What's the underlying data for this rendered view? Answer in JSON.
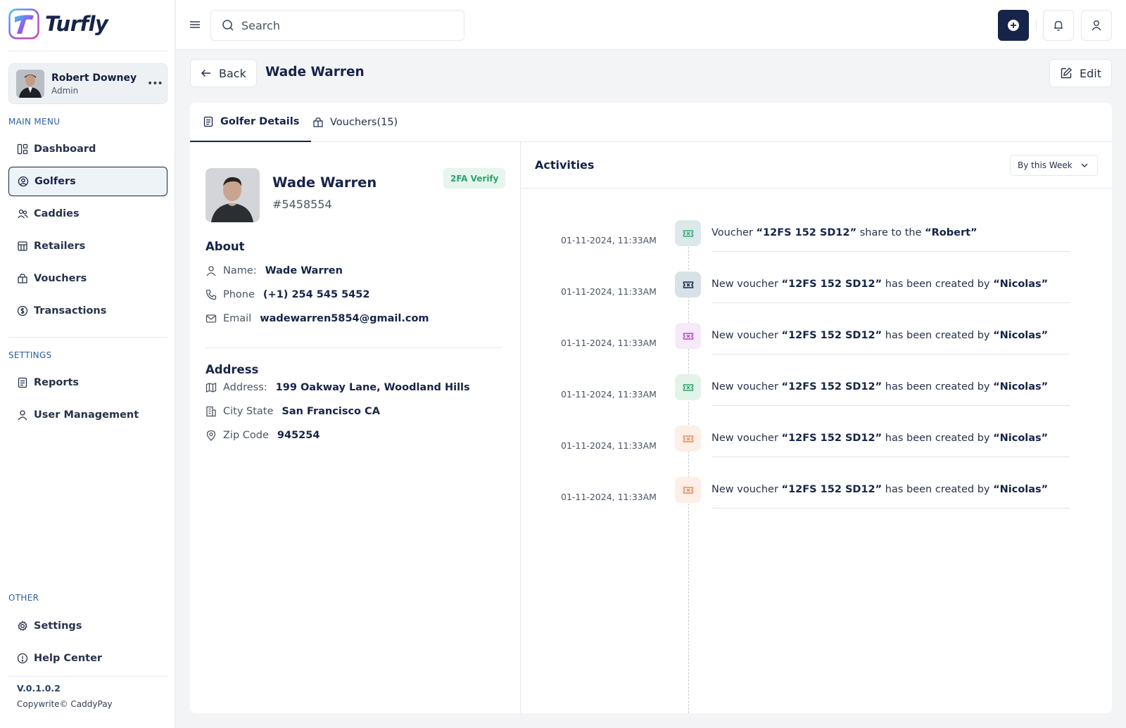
{
  "brand": {
    "name": "Turfly"
  },
  "user": {
    "name": "Robert Downey",
    "role": "Admin",
    "more": "•••"
  },
  "sidebar": {
    "main_label": "MAIN MENU",
    "main_items": [
      {
        "label": "Dashboard",
        "icon": "dashboard-icon"
      },
      {
        "label": "Golfers",
        "icon": "golfer-icon",
        "active": true
      },
      {
        "label": "Caddies",
        "icon": "users-icon"
      },
      {
        "label": "Retailers",
        "icon": "store-icon"
      },
      {
        "label": "Vouchers",
        "icon": "voucher-icon"
      },
      {
        "label": "Transactions",
        "icon": "dollar-icon"
      }
    ],
    "settings_label": "SETTINGS",
    "settings_items": [
      {
        "label": "Reports",
        "icon": "report-icon"
      },
      {
        "label": "User Management",
        "icon": "user-icon"
      }
    ],
    "other_label": "OTHER",
    "other_items": [
      {
        "label": "Settings",
        "icon": "gear-icon"
      },
      {
        "label": "Help Center",
        "icon": "info-icon"
      }
    ],
    "version": "V.0.1.0.2",
    "copyright": "Copywrite© CaddyPay"
  },
  "topbar": {
    "search_placeholder": "Search"
  },
  "header": {
    "back_label": "Back",
    "title": "Wade Warren",
    "edit_label": "Edit"
  },
  "tabs": [
    {
      "label": "Golfer Details",
      "active": true
    },
    {
      "label": "Vouchers(15)"
    }
  ],
  "golfer": {
    "name": "Wade Warren",
    "id": "#5458554",
    "badge": "2FA Verify",
    "about_title": "About",
    "about": [
      {
        "label": "Name:",
        "value": "Wade Warren",
        "icon": "person-icon"
      },
      {
        "label": "Phone",
        "value": "(+1) 254 545 5452",
        "icon": "phone-icon"
      },
      {
        "label": "Email",
        "value": "wadewarren5854@gmail.com",
        "icon": "mail-icon"
      }
    ],
    "address_title": "Address",
    "address": [
      {
        "label": "Address:",
        "value": "199 Oakway Lane, Woodland Hills",
        "icon": "map-icon"
      },
      {
        "label": "City State",
        "value": "San Francisco CA",
        "icon": "building-icon"
      },
      {
        "label": "Zip Code",
        "value": "945254",
        "icon": "pin-icon"
      }
    ]
  },
  "activities": {
    "title": "Activities",
    "filter": "By this Week",
    "items": [
      {
        "time": "01-11-2024, 11:33AM",
        "p1": "Voucher ",
        "b1": "“12FS 152 SD12”",
        "p2": " share to the ",
        "b2": "“Robert”",
        "color": "#3aa876",
        "bg": "#dde8ea"
      },
      {
        "time": "01-11-2024, 11:33AM",
        "p1": "New voucher ",
        "b1": "“12FS 152 SD12”",
        "p2": " has been created by ",
        "b2": "“Nicolas”",
        "color": "#16244a",
        "bg": "#d7e2e8"
      },
      {
        "time": "01-11-2024, 11:33AM",
        "p1": "New voucher ",
        "b1": "“12FS 152 SD12”",
        "p2": " has been created by ",
        "b2": "“Nicolas”",
        "color": "#c142d6",
        "bg": "#f7e9f9"
      },
      {
        "time": "01-11-2024, 11:33AM",
        "p1": "New voucher ",
        "b1": "“12FS 152 SD12”",
        "p2": " has been created by ",
        "b2": "“Nicolas”",
        "color": "#2fa56a",
        "bg": "#e2f3ea"
      },
      {
        "time": "01-11-2024, 11:33AM",
        "p1": "New voucher ",
        "b1": "“12FS 152 SD12”",
        "p2": " has been created by ",
        "b2": "“Nicolas”",
        "color": "#f08a5b",
        "bg": "#fdeee6"
      },
      {
        "time": "01-11-2024, 11:33AM",
        "p1": "New voucher ",
        "b1": "“12FS 152 SD12”",
        "p2": " has been created by ",
        "b2": "“Nicolas”",
        "color": "#f08a5b",
        "bg": "#fdeee6"
      }
    ]
  }
}
